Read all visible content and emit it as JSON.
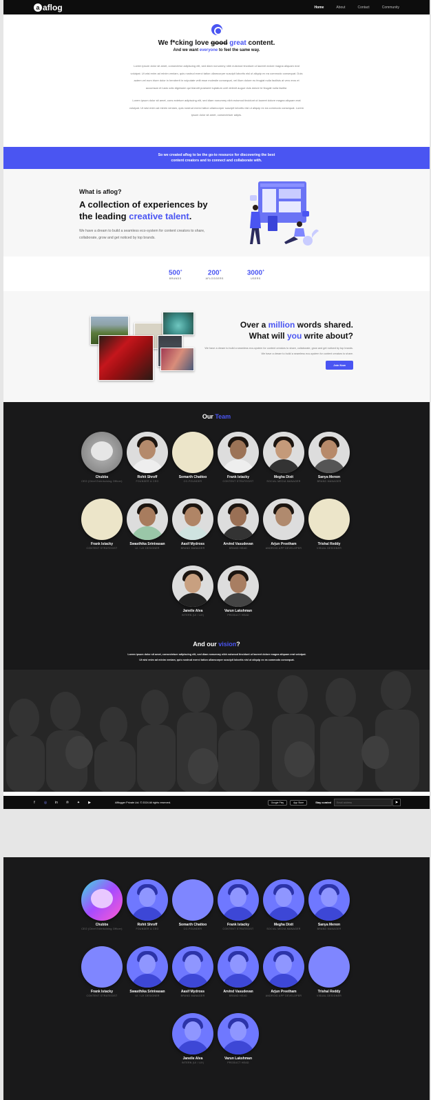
{
  "nav": {
    "logo_text": "aflog",
    "links": [
      "Home",
      "About",
      "Contact",
      "Community"
    ]
  },
  "hero": {
    "title_a": "We f*cking love",
    "title_strike": "good",
    "title_accent": "great",
    "title_b": "content.",
    "sub_a": "And we want",
    "sub_accent": "everyone",
    "sub_b": "to feel the same way.",
    "para1": "Lorem ipsum dolor sit amet, consectetur adipiscing elit, sed diam nonummy nibh euismod tincidunt ut laoreet dolore magna aliquam erat volutpat. Ut wisi enim ad minim veniam, quis nostrud exerci tation ullamcorper suscipit lobortis nisl ut aliquip ex ea commodo consequat. Duis autem vel eum iriure dolor in hendrerit in vulputate velit esse molestie consequat, vel illum dolore eu feugiat nulla facilisis at vero eros et accumsan et iusto odio dignissim qui blandit praesent luptatum zzril delenit augue duis dolore te feugait nulla facilisi.",
    "para2": "Lorem ipsum dolor sit amet, cons ectetuer adipiscing elit, sed diam nonummy nibh euismod tincidunt ut laoreet dolore magna aliquam erat volutpat. Ut wisi enim ad minim veniam, quis nostrud exerci tation ullamcorper suscipit lobortis nisl ut aliquip ex ea commodo consequat. Lorem ipsum dolor sit amet, consectetuer adipis."
  },
  "band": {
    "line1": "So we created aflog to be the go-to resource for discovering the best",
    "line2": "content creators and to connect and collaborate with."
  },
  "what": {
    "question": "What is aflog?",
    "heading_a": "A collection of experiences by",
    "heading_b": "the leading",
    "heading_accent": "creative talent",
    "heading_end": ".",
    "body": "We have a dream to build a seamless eco-system for content creators to share, collaborate, grow and get noticed by top brands."
  },
  "stats": [
    {
      "value": "500",
      "sup": "+",
      "label": "BRANDS"
    },
    {
      "value": "200",
      "sup": "+",
      "label": "AFLOGGERS"
    },
    {
      "value": "3000",
      "sup": "+",
      "label": "USERS"
    }
  ],
  "words": {
    "line1_a": "Over a",
    "line1_accent": "million",
    "line1_b": "words shared.",
    "line2_a": "What will",
    "line2_accent": "you",
    "line2_b": "write about?",
    "body": "We have a dream to build a seamless eco-system for content creators to share, collaborate, grow and get noticed by top brands. We have a dream to build a seamless eco-system for content creators to share.",
    "button": "Join Now"
  },
  "team": {
    "title_a": "Our",
    "title_accent": "Team",
    "members": [
      {
        "name": "Chubbs",
        "role": "CEO (Chief Entertaining Officer)"
      },
      {
        "name": "Rohit Shroff",
        "role": "FOUNDER & CEO"
      },
      {
        "name": "Somarth Chattoo",
        "role": "CO-FOUNDER"
      },
      {
        "name": "Frank Istacky",
        "role": "CONTENT STRATEGIST"
      },
      {
        "name": "Megha Dixit",
        "role": "SOCIAL MEDIA MANAGER"
      },
      {
        "name": "Sanya Menon",
        "role": "BRAND MANAGER"
      },
      {
        "name": "Frank Istacky",
        "role": "CONTENT STRATEGIST"
      },
      {
        "name": "Swasthika Srinivasan",
        "role": "UI / UX DESIGNER"
      },
      {
        "name": "Aasif Mydross",
        "role": "BRAND MANAGER"
      },
      {
        "name": "Arvind Vasudevan",
        "role": "BRAND HEAD"
      },
      {
        "name": "Arjun Preetham",
        "role": "ANDROID APP DEVELOPER"
      },
      {
        "name": "Trishal Reddy",
        "role": "VISUAL DESIGNER"
      },
      {
        "name": "Janelle Alva",
        "role": "INTERN (UI / UX)"
      },
      {
        "name": "Varun Lakshman",
        "role": "PRODUCT HEAD"
      }
    ]
  },
  "vision": {
    "title_a": "And our",
    "title_accent": "vision",
    "title_end": "?",
    "line1": "Lorem ipsum dolor sit amet, consectetuer adipiscing elit, sed diam nonummy nibh euismod tincidunt ut laoreet dolore magna aliquam erat volutpat.",
    "line2": "Ut wisi enim ad minim veniam, quis nostrud exerci tation ullamcorper suscipit lobortis nisl ut aliquip ex ea commodo consequat."
  },
  "footer": {
    "social_icons": [
      "facebook-icon",
      "instagram-icon",
      "linkedin-icon",
      "pinterest-icon",
      "twitter-icon",
      "youtube-icon"
    ],
    "copyright": "Afflogger Private Ltd. © 2024 All rights reserved.",
    "google_play": "Google Play",
    "app_store": "App Store",
    "stay": "Stay curated",
    "email_placeholder": "Email address"
  },
  "colors": {
    "accent": "#4a55f2",
    "dark": "#19191a",
    "avatar_placeholder": "#ece5c9"
  }
}
